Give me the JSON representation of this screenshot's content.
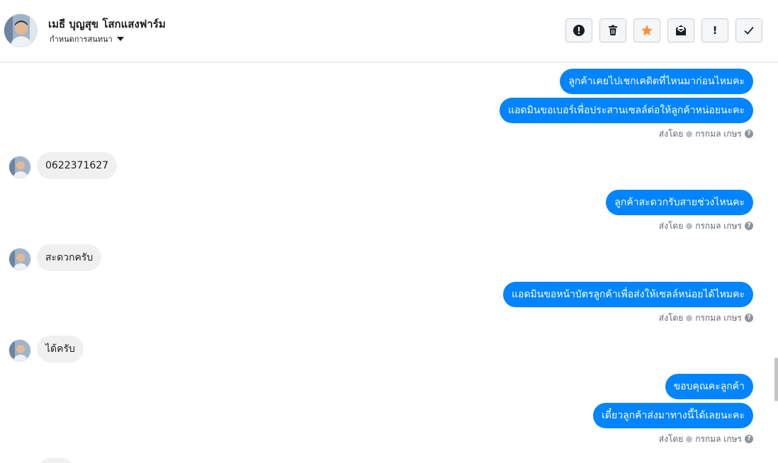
{
  "header": {
    "contact_name": "เมธี บุญสุข โสกแสงฟาร์ม",
    "assign_label": "กำหนดการสนทนา"
  },
  "toolbar": {
    "buttons": [
      {
        "icon": "alert-circle-icon",
        "label": ""
      },
      {
        "icon": "trash-icon",
        "label": ""
      },
      {
        "icon": "star-icon",
        "label": "",
        "color": "#f7923b"
      },
      {
        "icon": "mark-unread-icon",
        "label": ""
      },
      {
        "icon": "exclamation-icon",
        "label": "!"
      },
      {
        "icon": "check-icon",
        "label": ""
      }
    ]
  },
  "colors": {
    "outgoing_bubble": "#0084ff",
    "incoming_bubble": "#f0f0f0",
    "star": "#f7923b"
  },
  "thread": {
    "messages": [
      {
        "dir": "out",
        "text": "ลูกค้าเคยไปเชกเคดิตที่ไหนมาก่อนไหมคะ"
      },
      {
        "dir": "out",
        "text": "แอดมินขอเบอร์เพื่อประสานเซลล์ต่อให้ลูกค้าหน่อยนะคะ"
      },
      {
        "dir": "sent-by",
        "prefix": "ส่งโดย",
        "name": "กรกมล เกษร"
      },
      {
        "dir": "in",
        "text": "0622371627"
      },
      {
        "dir": "out",
        "text": "ลูกค้าสะดวกรับสายช่วงไหนคะ"
      },
      {
        "dir": "sent-by",
        "prefix": "ส่งโดย",
        "name": "กรกมล เกษร"
      },
      {
        "dir": "in",
        "text": "สะดวกครับ"
      },
      {
        "dir": "out",
        "text": "แอดมินขอหน้าบัตรลูกค้าเพื่อส่งให้เซลล์หน่อยได้ไหมคะ"
      },
      {
        "dir": "sent-by",
        "prefix": "ส่งโดย",
        "name": "กรกมล เกษร"
      },
      {
        "dir": "in",
        "text": "ได้ครับ"
      },
      {
        "dir": "out",
        "text": "ขอบคุณคะลูกค้า"
      },
      {
        "dir": "out",
        "text": "เดี๋ยวลูกค้าส่งมาทางนี้ได้เลยนะคะ"
      },
      {
        "dir": "sent-by",
        "prefix": "ส่งโดย",
        "name": "กรกมล เกษร"
      }
    ]
  }
}
